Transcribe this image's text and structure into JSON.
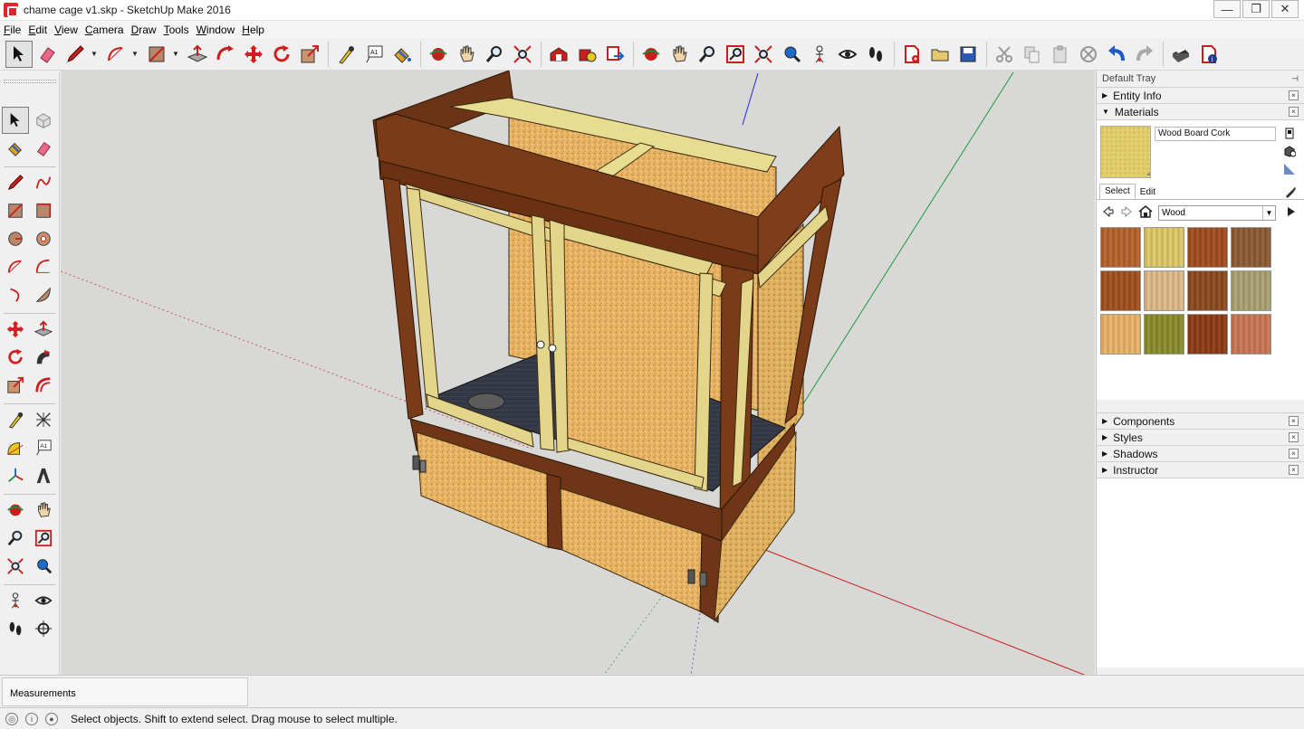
{
  "window": {
    "title": "chame cage v1.skp - SketchUp Make 2016",
    "minimize": "—",
    "restore": "❐",
    "close": "✕"
  },
  "menu": [
    {
      "u": "F",
      "rest": "ile"
    },
    {
      "u": "E",
      "rest": "dit"
    },
    {
      "u": "V",
      "rest": "iew"
    },
    {
      "u": "C",
      "rest": "amera"
    },
    {
      "u": "D",
      "rest": "raw"
    },
    {
      "u": "T",
      "rest": "ools"
    },
    {
      "u": "W",
      "rest": "indow"
    },
    {
      "u": "H",
      "rest": "elp"
    }
  ],
  "toolbar": {
    "icons": [
      "select-icon",
      "eraser-icon",
      "pencil-icon",
      "arc-icon",
      "rectangle-icon",
      "push-pull-icon",
      "follow-me-icon",
      "move-icon",
      "rotate-icon",
      "scale-icon",
      "tape-measure-icon",
      "text-icon",
      "paint-bucket-icon",
      "orbit-icon",
      "pan-icon",
      "zoom-icon",
      "zoom-extents-icon",
      "warehouse-icon",
      "extension-warehouse-icon",
      "share-model-icon",
      "orbit-icon-2",
      "pan-icon-2",
      "zoom-icon-2",
      "zoom-window-icon",
      "zoom-extents-icon-2",
      "previous-view-icon",
      "position-camera-icon",
      "look-around-icon",
      "walk-icon",
      "new-file-icon",
      "open-file-icon",
      "save-file-icon",
      "cut-icon",
      "copy-icon",
      "paste-icon",
      "delete-icon",
      "undo-icon",
      "redo-icon",
      "print-icon",
      "model-info-icon"
    ]
  },
  "tray": {
    "title": "Default Tray",
    "pin": "📌",
    "panels_top": [
      {
        "name": "Entity Info",
        "expanded": false
      },
      {
        "name": "Materials",
        "expanded": true
      }
    ],
    "materials": {
      "name": "Wood Board Cork",
      "tab_select": "Select",
      "tab_edit": "Edit",
      "library": "Wood",
      "swatch_colors": [
        "#b4622a",
        "#dcc864",
        "#a04c1e",
        "#8c5a32",
        "#a0501e",
        "#ddb98a",
        "#8a4a20",
        "#a8a072",
        "#e8b266",
        "#8a8a2a",
        "#8c3a14",
        "#c87654"
      ]
    },
    "panels_bottom": [
      {
        "name": "Components"
      },
      {
        "name": "Styles"
      },
      {
        "name": "Shadows"
      },
      {
        "name": "Instructor"
      }
    ]
  },
  "measurements": {
    "label": "Measurements"
  },
  "status": {
    "text": "Select objects. Shift to extend select. Drag mouse to select multiple."
  }
}
